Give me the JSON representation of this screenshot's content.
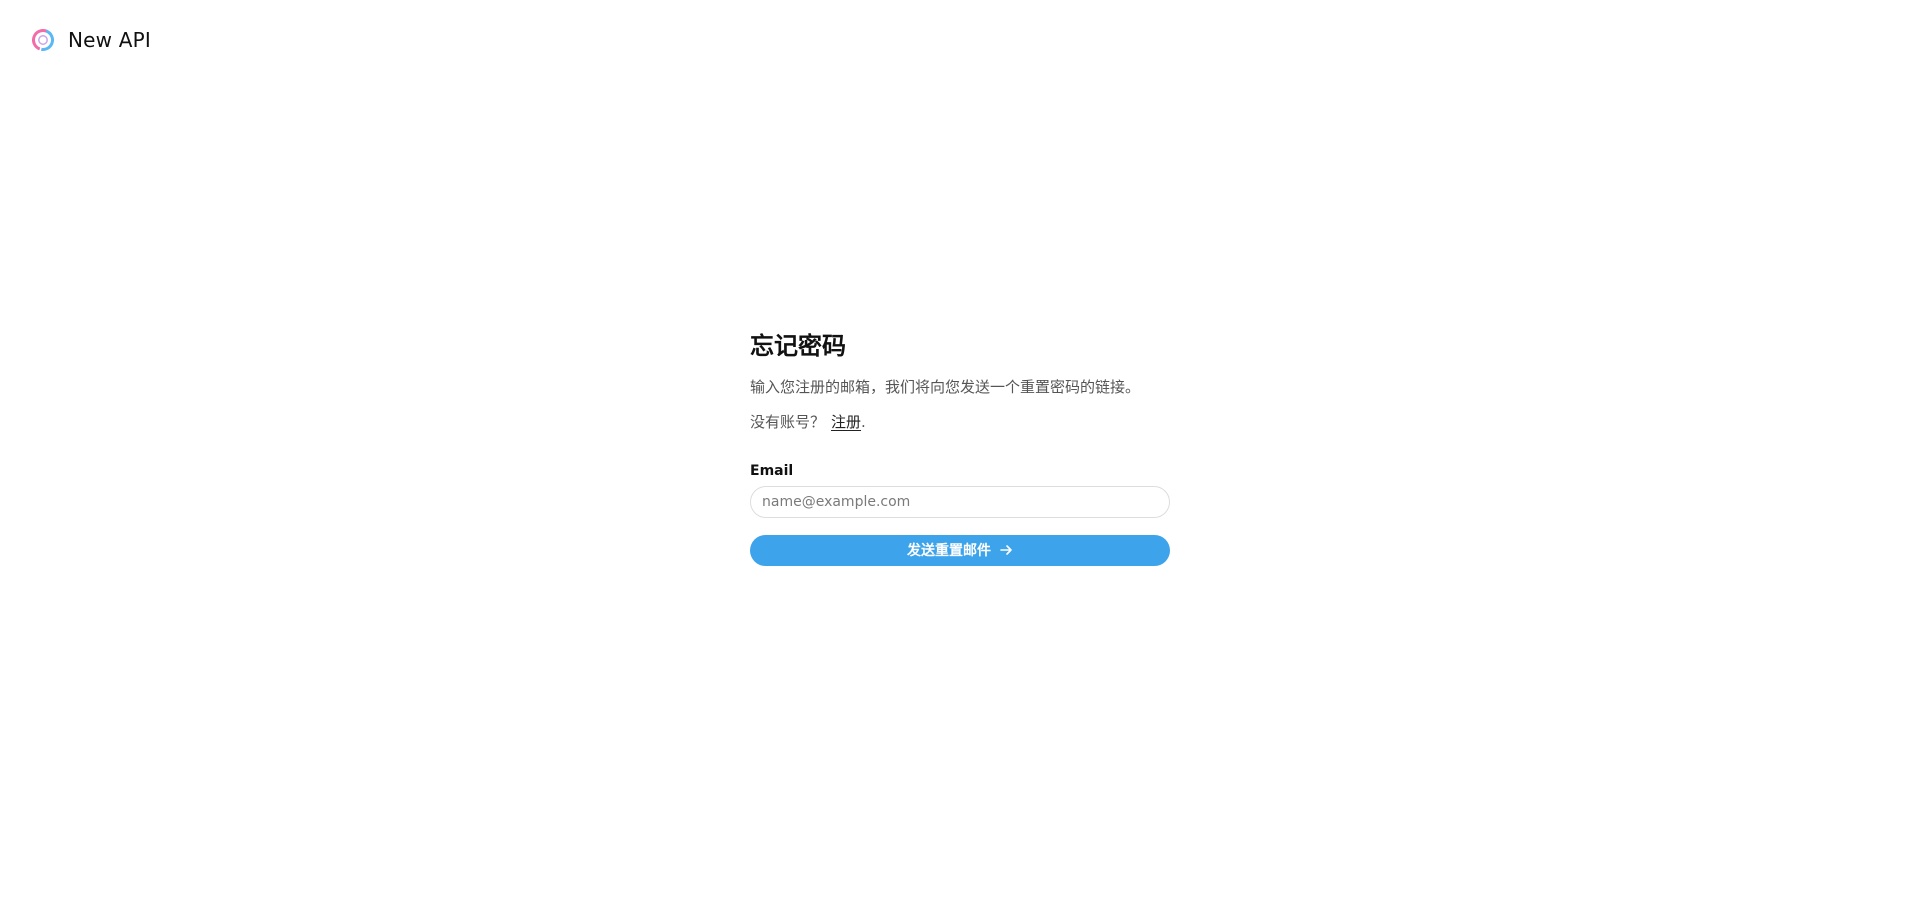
{
  "header": {
    "app_name": "New API",
    "logo_icon": "new-api-logo-icon"
  },
  "form": {
    "title": "忘记密码",
    "subtitle": "输入您注册的邮箱，我们将向您发送一个重置密码的链接。",
    "no_account_text": "没有账号？",
    "signup_link": "注册",
    "signup_suffix": ".",
    "email_label": "Email",
    "email_placeholder": "name@example.com",
    "email_value": "",
    "submit_label": "发送重置邮件",
    "submit_icon": "arrow-right-icon"
  },
  "colors": {
    "primary": "#3da3eb",
    "logo_pink": "#f26ca7",
    "logo_blue": "#5ab8f5"
  }
}
